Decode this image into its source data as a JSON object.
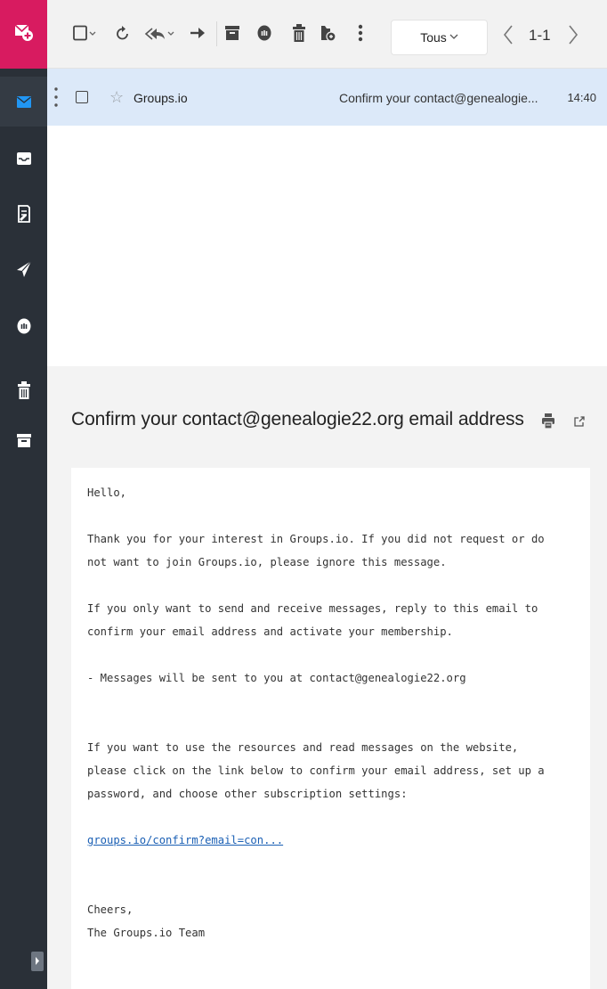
{
  "toolbar": {
    "filter_label": "Tous",
    "pagination": "1-1"
  },
  "message_list": [
    {
      "sender": "Groups.io",
      "subject": "Confirm your contact@genealogie...",
      "time": "14:40"
    }
  ],
  "reader": {
    "subject": "Confirm your contact@genealogie22.org email address",
    "body": {
      "greeting": "Hello,",
      "p1": "Thank you for your interest in Groups.io. If you did not request or do\nnot want to join Groups.io, please ignore this message.",
      "p2": "If you only want to send and receive messages, reply to this email to\nconfirm your email address and activate your membership.",
      "p3": "- Messages will be sent to you at contact@genealogie22.org",
      "p4": "If you want to use the resources and read messages on the website,\nplease click on the link below to confirm your email address, set up a\npassword, and choose other subscription settings:",
      "link": "groups.io/confirm?email=con...",
      "closing": "Cheers,",
      "signature": "The Groups.io Team"
    }
  },
  "colors": {
    "rail": "#2a3038",
    "compose": "#d81b60",
    "selected_row": "#dce9f9",
    "inbox_icon": "#2196f3"
  },
  "icons": {
    "rail": [
      "compose-icon",
      "inbox-icon",
      "tray-icon",
      "drafts-icon",
      "sent-icon",
      "spam-icon",
      "trash-icon",
      "archive-icon"
    ],
    "toolbar": [
      "select-checkbox-icon",
      "refresh-icon",
      "reply-all-icon",
      "forward-icon",
      "archive-icon",
      "spam-icon",
      "trash-icon",
      "move-to-folder-icon",
      "more-icon"
    ]
  }
}
